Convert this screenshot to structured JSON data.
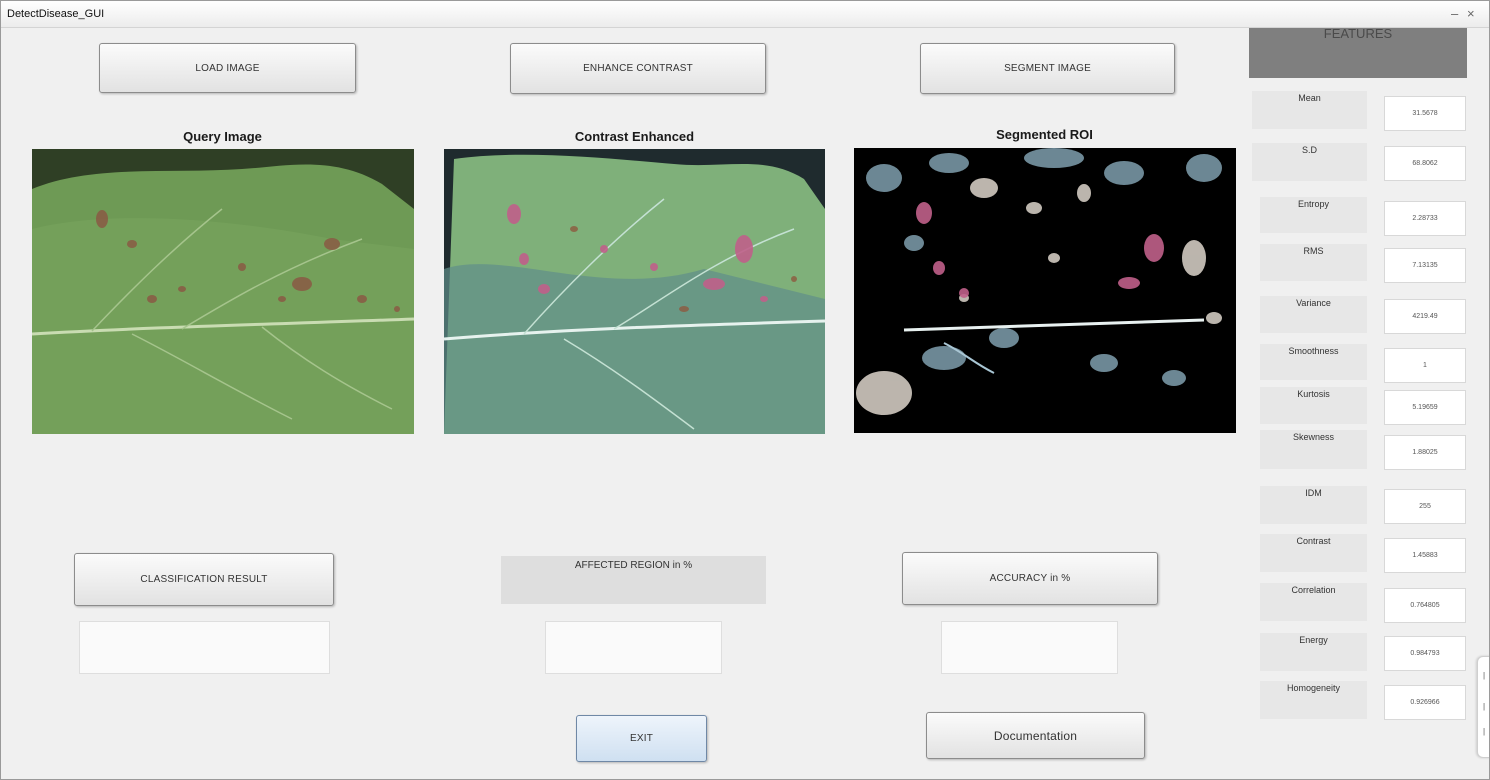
{
  "window": {
    "title": "DetectDisease_GUI",
    "minimize": "–",
    "close": "×"
  },
  "buttons": {
    "load": "LOAD IMAGE",
    "enhance": "ENHANCE CONTRAST",
    "segment": "SEGMENT IMAGE",
    "classification": "CLASSIFICATION RESULT",
    "accuracy": "ACCURACY in %",
    "exit": "EXIT",
    "documentation": "Documentation"
  },
  "panels": {
    "query": "Query Image",
    "contrast": "Contrast Enhanced",
    "segmented": "Segmented ROI"
  },
  "affected_label": "AFFECTED REGION in %",
  "results": {
    "classification": "",
    "affected": "",
    "accuracy": ""
  },
  "features": {
    "title": "FEATURES",
    "items": [
      {
        "label": "Mean",
        "value": "31.5678"
      },
      {
        "label": "S.D",
        "value": "68.8062"
      },
      {
        "label": "Entropy",
        "value": "2.28733"
      },
      {
        "label": "RMS",
        "value": "7.13135"
      },
      {
        "label": "Variance",
        "value": "4219.49"
      },
      {
        "label": "Smoothness",
        "value": "1"
      },
      {
        "label": "Kurtosis",
        "value": "5.19659"
      },
      {
        "label": "Skewness",
        "value": "1.88025"
      },
      {
        "label": "IDM",
        "value": "255"
      },
      {
        "label": "Contrast",
        "value": "1.45883"
      },
      {
        "label": "Correlation",
        "value": "0.764805"
      },
      {
        "label": "Energy",
        "value": "0.984793"
      },
      {
        "label": "Homogeneity",
        "value": "0.926966"
      }
    ]
  },
  "colors": {
    "window_bg": "#f0f0f0",
    "features_header": "#7f7f7f",
    "leaf_green": "#6f9a52",
    "lesion_brown": "#8a5a44",
    "lesion_pink": "#c0608a",
    "segmented_bg": "#000000"
  }
}
